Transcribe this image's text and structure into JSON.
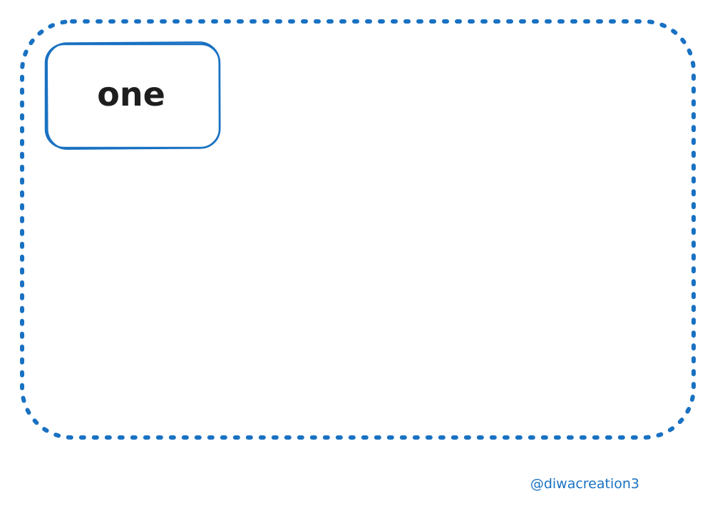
{
  "diagram": {
    "box_label": "one",
    "credit": "@diwacreation3"
  },
  "colors": {
    "stroke": "#1971c2",
    "text": "#1e1e1e",
    "background": "#ffffff"
  }
}
